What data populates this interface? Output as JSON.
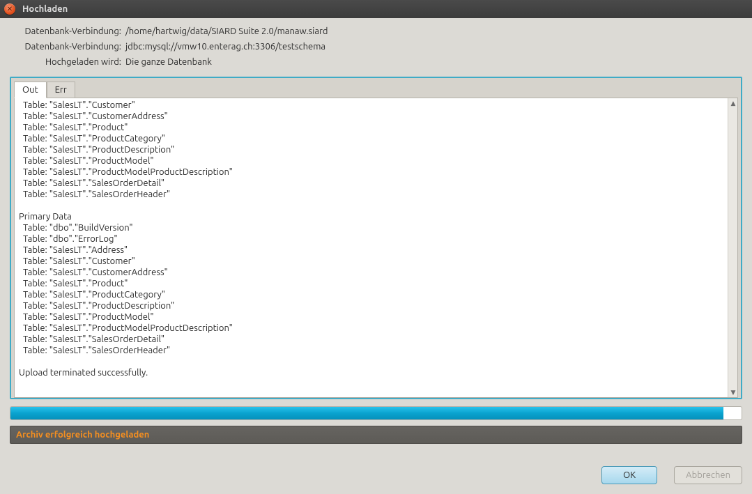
{
  "title": "Hochladen",
  "info": {
    "label_conn1": "Datenbank-Verbindung:",
    "value_conn1": "/home/hartwig/data/SIARD Suite 2.0/manaw.siard",
    "label_conn2": "Datenbank-Verbindung:",
    "value_conn2": "jdbc:mysql://vmw10.enterag.ch:3306/testschema",
    "label_uploaded": "Hochgeladen wird:",
    "value_uploaded": "Die ganze Datenbank"
  },
  "tabs": {
    "out": "Out",
    "err": "Err"
  },
  "log_text": "  Table: \"SalesLT\".\"Customer\"\n  Table: \"SalesLT\".\"CustomerAddress\"\n  Table: \"SalesLT\".\"Product\"\n  Table: \"SalesLT\".\"ProductCategory\"\n  Table: \"SalesLT\".\"ProductDescription\"\n  Table: \"SalesLT\".\"ProductModel\"\n  Table: \"SalesLT\".\"ProductModelProductDescription\"\n  Table: \"SalesLT\".\"SalesOrderDetail\"\n  Table: \"SalesLT\".\"SalesOrderHeader\"\n\nPrimary Data\n  Table: \"dbo\".\"BuildVersion\"\n  Table: \"dbo\".\"ErrorLog\"\n  Table: \"SalesLT\".\"Address\"\n  Table: \"SalesLT\".\"Customer\"\n  Table: \"SalesLT\".\"CustomerAddress\"\n  Table: \"SalesLT\".\"Product\"\n  Table: \"SalesLT\".\"ProductCategory\"\n  Table: \"SalesLT\".\"ProductDescription\"\n  Table: \"SalesLT\".\"ProductModel\"\n  Table: \"SalesLT\".\"ProductModelProductDescription\"\n  Table: \"SalesLT\".\"SalesOrderDetail\"\n  Table: \"SalesLT\".\"SalesOrderHeader\"\n\nUpload terminated successfully.\n",
  "status": "Archiv erfolgreich hochgeladen",
  "buttons": {
    "ok": "OK",
    "cancel": "Abbrechen"
  }
}
